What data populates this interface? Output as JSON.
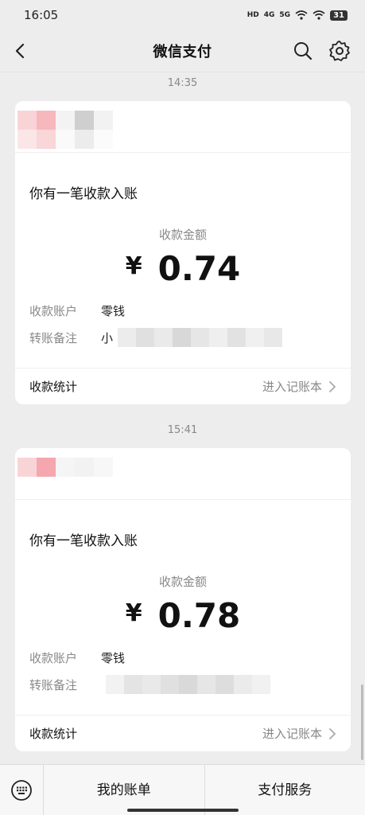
{
  "status_bar": {
    "time": "16:05",
    "hd_label": "HD",
    "signal_4g": "4G",
    "signal_5g": "5G",
    "battery": "31"
  },
  "header": {
    "title": "微信支付",
    "icons": {
      "back": "chevron-left-icon",
      "search": "search-icon",
      "settings": "gear-icon"
    }
  },
  "messages": [
    {
      "time": "14:35",
      "title": "你有一笔收款入账",
      "amount_label": "收款金额",
      "currency": "¥",
      "amount": "0.74",
      "account_key": "收款账户",
      "account_value": "零钱",
      "note_key": "转账备注",
      "note_value": "小",
      "footer_left": "收款统计",
      "footer_right": "进入记账本"
    },
    {
      "time": "15:41",
      "title": "你有一笔收款入账",
      "amount_label": "收款金额",
      "currency": "¥",
      "amount": "0.78",
      "account_key": "收款账户",
      "account_value": "零钱",
      "note_key": "转账备注",
      "note_value": "",
      "footer_left": "收款统计",
      "footer_right": "进入记账本"
    }
  ],
  "bottom_bar": {
    "keyboard_icon": "keyboard-icon",
    "tabs": [
      "我的账单",
      "支付服务"
    ]
  }
}
